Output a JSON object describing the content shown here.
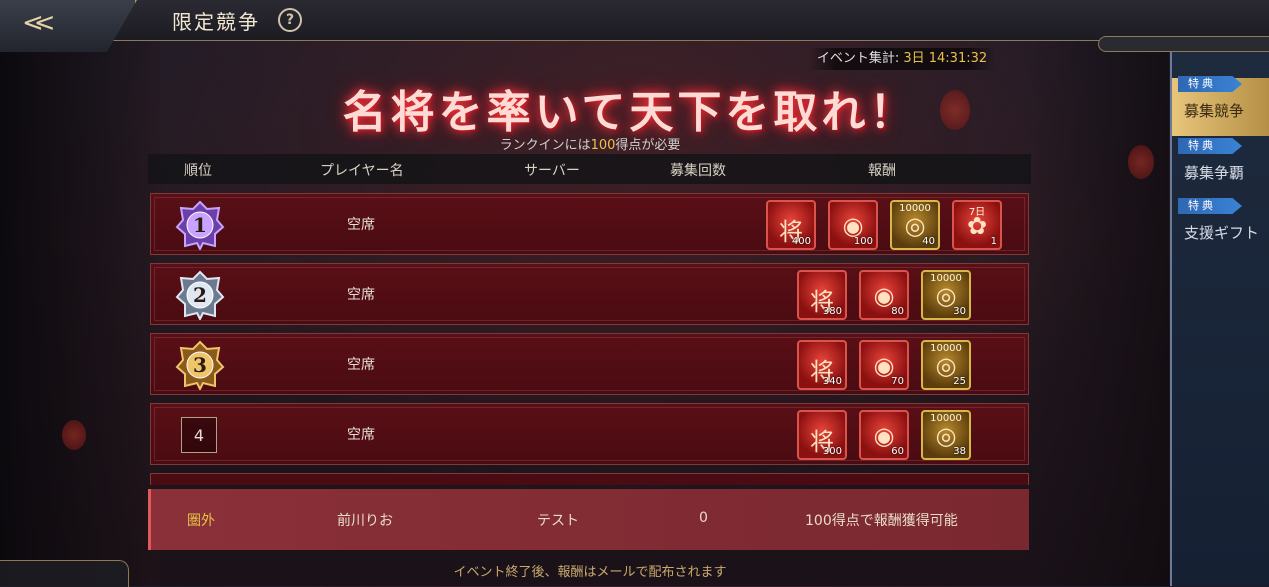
{
  "header": {
    "title": "限定競争",
    "back_label": "<<",
    "help_label": "?"
  },
  "event": {
    "timer_label": "イベント集計:",
    "timer_value": "3日 14:31:32"
  },
  "banner": {
    "headline": "名将を率いて天下を取れ！",
    "sub_pre": "ランクインには",
    "sub_num": "100",
    "sub_post": "得点が必要"
  },
  "table": {
    "headers": [
      "順位",
      "プレイヤー名",
      "サーバー",
      "募集回数",
      "報酬"
    ],
    "rows": [
      {
        "rank": "1",
        "player": "空席",
        "rewards": [
          {
            "type": "red",
            "glyph": "将",
            "top": "",
            "qty": "400"
          },
          {
            "type": "red",
            "glyph": "◉",
            "top": "",
            "qty": "100"
          },
          {
            "type": "gold",
            "glyph": "◎",
            "top": "10000",
            "qty": "40"
          },
          {
            "type": "red",
            "glyph": "✿",
            "top": "7日",
            "qty": "1"
          }
        ]
      },
      {
        "rank": "2",
        "player": "空席",
        "rewards": [
          {
            "type": "red",
            "glyph": "将",
            "top": "",
            "qty": "380"
          },
          {
            "type": "red",
            "glyph": "◉",
            "top": "",
            "qty": "80"
          },
          {
            "type": "gold",
            "glyph": "◎",
            "top": "10000",
            "qty": "30"
          }
        ]
      },
      {
        "rank": "3",
        "player": "空席",
        "rewards": [
          {
            "type": "red",
            "glyph": "将",
            "top": "",
            "qty": "340"
          },
          {
            "type": "red",
            "glyph": "◉",
            "top": "",
            "qty": "70"
          },
          {
            "type": "gold",
            "glyph": "◎",
            "top": "10000",
            "qty": "25"
          }
        ]
      },
      {
        "rank": "4",
        "player": "空席",
        "rewards": [
          {
            "type": "red",
            "glyph": "将",
            "top": "",
            "qty": "300"
          },
          {
            "type": "red",
            "glyph": "◉",
            "top": "",
            "qty": "60"
          },
          {
            "type": "gold",
            "glyph": "◎",
            "top": "10000",
            "qty": "38"
          }
        ]
      }
    ]
  },
  "my_rank": {
    "rank": "圏外",
    "player": "前川りお",
    "server": "テスト",
    "count": "0",
    "reward_note": "100得点で報酬獲得可能"
  },
  "footer": "イベント終了後、報酬はメールで配布されます",
  "sidebar": {
    "tabs": [
      {
        "badge": "特典",
        "label": "募集競争",
        "active": true
      },
      {
        "badge": "特典",
        "label": "募集争覇",
        "active": false
      },
      {
        "badge": "特典",
        "label": "支援ギフト",
        "active": false
      }
    ]
  },
  "colors": {
    "accent_gold": "#e8c24a",
    "row_red": "#5a0f16",
    "tab_active": "#e7c57a"
  }
}
